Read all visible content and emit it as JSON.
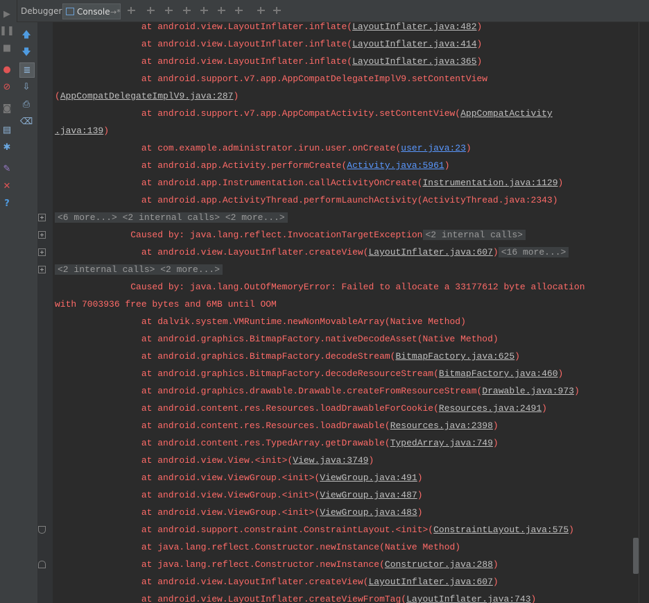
{
  "tabs": {
    "debugger": "Debugger",
    "console": "Console",
    "console_pin": "→*"
  },
  "colors": {
    "error_red": "#ff6b68",
    "link_blue": "#5a98ff",
    "link_gray": "#c0c0c0",
    "background": "#2b2b2b"
  },
  "console": {
    "lines": [
      {
        "indent": "                ",
        "parts": [
          {
            "t": "at android.view.LayoutInflater.inflate("
          },
          {
            "t": "LayoutInflater.java:482",
            "link": true
          },
          {
            "t": ")"
          }
        ]
      },
      {
        "indent": "                ",
        "parts": [
          {
            "t": "at android.view.LayoutInflater.inflate("
          },
          {
            "t": "LayoutInflater.java:414",
            "link": true
          },
          {
            "t": ")"
          }
        ]
      },
      {
        "indent": "                ",
        "parts": [
          {
            "t": "at android.view.LayoutInflater.inflate("
          },
          {
            "t": "LayoutInflater.java:365",
            "link": true
          },
          {
            "t": ")"
          }
        ]
      },
      {
        "indent": "                ",
        "parts": [
          {
            "t": "at android.support.v7.app.AppCompatDelegateImplV9.setContentView"
          }
        ]
      },
      {
        "indent": "",
        "parts": [
          {
            "t": "("
          },
          {
            "t": "AppCompatDelegateImplV9.java:287",
            "link": true
          },
          {
            "t": ")"
          }
        ]
      },
      {
        "indent": "                ",
        "parts": [
          {
            "t": "at android.support.v7.app.AppCompatActivity.setContentView("
          },
          {
            "t": "AppCompatActivity",
            "link": true
          }
        ]
      },
      {
        "indent": "",
        "parts": [
          {
            "t": ".java:139",
            "link": true
          },
          {
            "t": ")"
          }
        ]
      },
      {
        "indent": "                ",
        "parts": [
          {
            "t": "at com.example.administrator.irun.user.onCreate("
          },
          {
            "t": "user.java:23",
            "blue": true
          },
          {
            "t": ")"
          }
        ]
      },
      {
        "indent": "                ",
        "parts": [
          {
            "t": "at android.app.Activity.performCreate("
          },
          {
            "t": "Activity.java:5961",
            "blue": true
          },
          {
            "t": ")"
          }
        ]
      },
      {
        "indent": "                ",
        "parts": [
          {
            "t": "at android.app.Instrumentation.callActivityOnCreate("
          },
          {
            "t": "Instrumentation.java:1129",
            "link": true
          },
          {
            "t": ")"
          }
        ]
      },
      {
        "indent": "                ",
        "parts": [
          {
            "t": "at android.app.ActivityThread.performLaunchActivity(ActivityThread.java:2343)"
          }
        ]
      },
      {
        "indent": "",
        "parts": [
          {
            "t": "<6 more...> <2 internal calls> <2 more...>",
            "chip": true
          }
        ],
        "fold": true
      },
      {
        "indent": "              ",
        "parts": [
          {
            "t": "Caused by: java.lang.reflect.InvocationTargetException"
          },
          {
            "t": "<2 internal calls>",
            "chip": true
          }
        ],
        "fold": true
      },
      {
        "indent": "                ",
        "parts": [
          {
            "t": "at android.view.LayoutInflater.createView("
          },
          {
            "t": "LayoutInflater.java:607",
            "link": true
          },
          {
            "t": ")"
          },
          {
            "t": "<16 more...>",
            "chip": true
          }
        ],
        "fold": true
      },
      {
        "indent": "",
        "parts": [
          {
            "t": "<2 internal calls> <2 more...>",
            "chip": true
          }
        ],
        "fold": true
      },
      {
        "indent": "              ",
        "parts": [
          {
            "t": "Caused by: java.lang.OutOfMemoryError: Failed to allocate a 33177612 byte allocation"
          }
        ]
      },
      {
        "indent": "",
        "parts": [
          {
            "t": "with 7003936 free bytes and 6MB until OOM"
          }
        ]
      },
      {
        "indent": "                ",
        "parts": [
          {
            "t": "at dalvik.system.VMRuntime.newNonMovableArray(Native Method)"
          }
        ]
      },
      {
        "indent": "                ",
        "parts": [
          {
            "t": "at android.graphics.BitmapFactory.nativeDecodeAsset(Native Method)"
          }
        ]
      },
      {
        "indent": "                ",
        "parts": [
          {
            "t": "at android.graphics.BitmapFactory.decodeStream("
          },
          {
            "t": "BitmapFactory.java:625",
            "link": true
          },
          {
            "t": ")"
          }
        ]
      },
      {
        "indent": "                ",
        "parts": [
          {
            "t": "at android.graphics.BitmapFactory.decodeResourceStream("
          },
          {
            "t": "BitmapFactory.java:460",
            "link": true
          },
          {
            "t": ")"
          }
        ]
      },
      {
        "indent": "                ",
        "parts": [
          {
            "t": "at android.graphics.drawable.Drawable.createFromResourceStream("
          },
          {
            "t": "Drawable.java:973",
            "link": true
          },
          {
            "t": ")"
          }
        ]
      },
      {
        "indent": "                ",
        "parts": [
          {
            "t": "at android.content.res.Resources.loadDrawableForCookie("
          },
          {
            "t": "Resources.java:2491",
            "link": true
          },
          {
            "t": ")"
          }
        ]
      },
      {
        "indent": "                ",
        "parts": [
          {
            "t": "at android.content.res.Resources.loadDrawable("
          },
          {
            "t": "Resources.java:2398",
            "link": true
          },
          {
            "t": ")"
          }
        ]
      },
      {
        "indent": "                ",
        "parts": [
          {
            "t": "at android.content.res.TypedArray.getDrawable("
          },
          {
            "t": "TypedArray.java:749",
            "link": true
          },
          {
            "t": ")"
          }
        ]
      },
      {
        "indent": "                ",
        "parts": [
          {
            "t": "at android.view.View.<init>("
          },
          {
            "t": "View.java:3749",
            "link": true
          },
          {
            "t": ")"
          }
        ]
      },
      {
        "indent": "                ",
        "parts": [
          {
            "t": "at android.view.ViewGroup.<init>("
          },
          {
            "t": "ViewGroup.java:491",
            "link": true
          },
          {
            "t": ")"
          }
        ]
      },
      {
        "indent": "                ",
        "parts": [
          {
            "t": "at android.view.ViewGroup.<init>("
          },
          {
            "t": "ViewGroup.java:487",
            "link": true
          },
          {
            "t": ")"
          }
        ]
      },
      {
        "indent": "                ",
        "parts": [
          {
            "t": "at android.view.ViewGroup.<init>("
          },
          {
            "t": "ViewGroup.java:483",
            "link": true
          },
          {
            "t": ")"
          }
        ]
      },
      {
        "indent": "                ",
        "parts": [
          {
            "t": "at android.support.constraint.ConstraintLayout.<init>("
          },
          {
            "t": "ConstraintLayout.java:575",
            "link": true
          },
          {
            "t": ")"
          }
        ]
      },
      {
        "indent": "                ",
        "parts": [
          {
            "t": "at java.lang.reflect.Constructor.newInstance(Native Method)"
          }
        ]
      },
      {
        "indent": "                ",
        "parts": [
          {
            "t": "at java.lang.reflect.Constructor.newInstance("
          },
          {
            "t": "Constructor.java:288",
            "link": true
          },
          {
            "t": ")"
          }
        ]
      },
      {
        "indent": "                ",
        "parts": [
          {
            "t": "at android.view.LayoutInflater.createView("
          },
          {
            "t": "LayoutInflater.java:607",
            "link": true
          },
          {
            "t": ")"
          }
        ]
      },
      {
        "indent": "                ",
        "parts": [
          {
            "t": "at android.view.LayoutInflater.createViewFromTag("
          },
          {
            "t": "LayoutInflater.java:743",
            "link": true
          },
          {
            "t": ")"
          }
        ]
      }
    ]
  },
  "icons": {
    "toolbar": [
      "scroll-to-end-icon",
      "step-over-icon",
      "step-into-icon",
      "force-step-into-icon",
      "step-out-icon",
      "drop-frame-icon",
      "run-to-cursor-icon",
      "evaluate-icon",
      "layout-icon"
    ],
    "left_outer": [
      "resume-icon",
      "pause-icon",
      "stop-icon",
      "view-breakpoints-icon",
      "mute-breakpoints-icon",
      "camera-icon",
      "restore-layout-icon",
      "settings-icon",
      "pin-icon",
      "close-icon",
      "help-icon"
    ],
    "left_inner": [
      "up-arrow-icon",
      "down-arrow-icon",
      "soft-wrap-icon",
      "scroll-to-end-icon",
      "print-icon",
      "clear-all-icon"
    ]
  }
}
